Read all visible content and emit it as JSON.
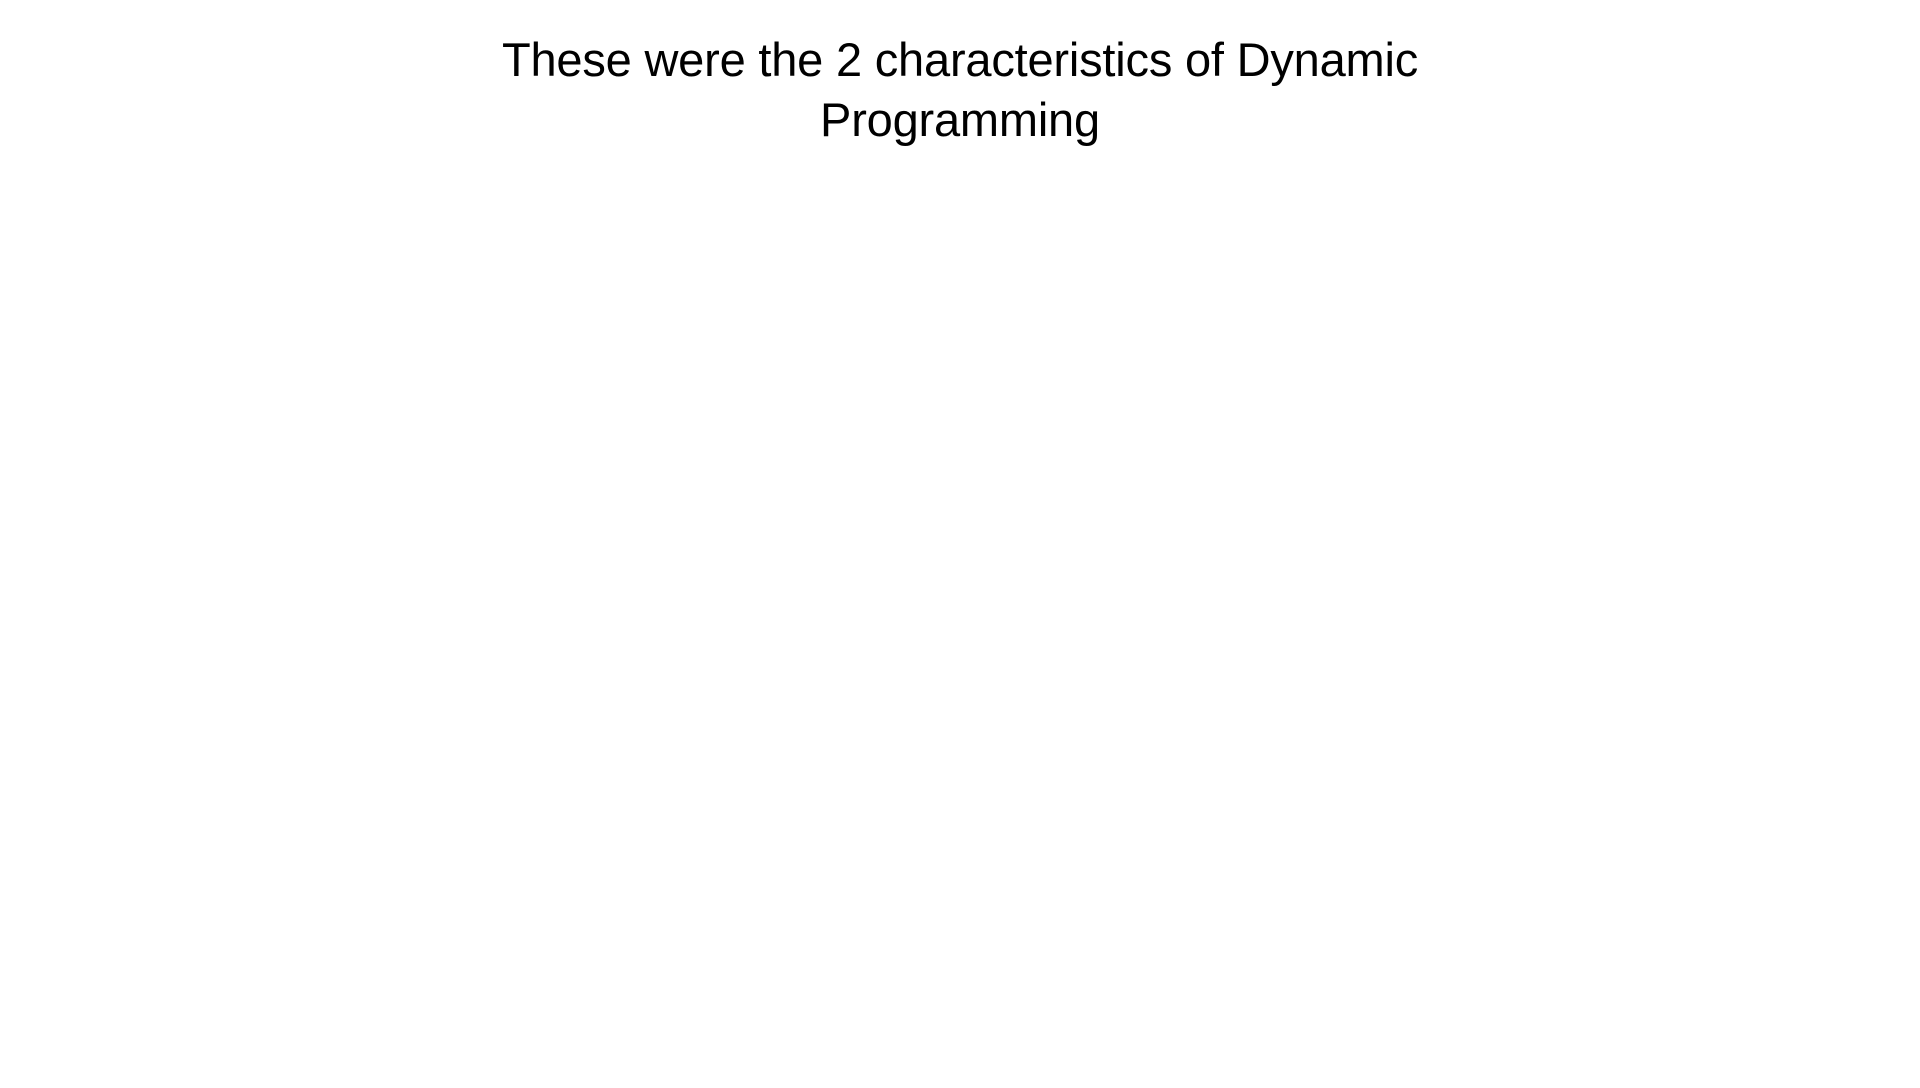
{
  "slide": {
    "title": "These were the 2 characteristics of Dynamic Programming"
  }
}
